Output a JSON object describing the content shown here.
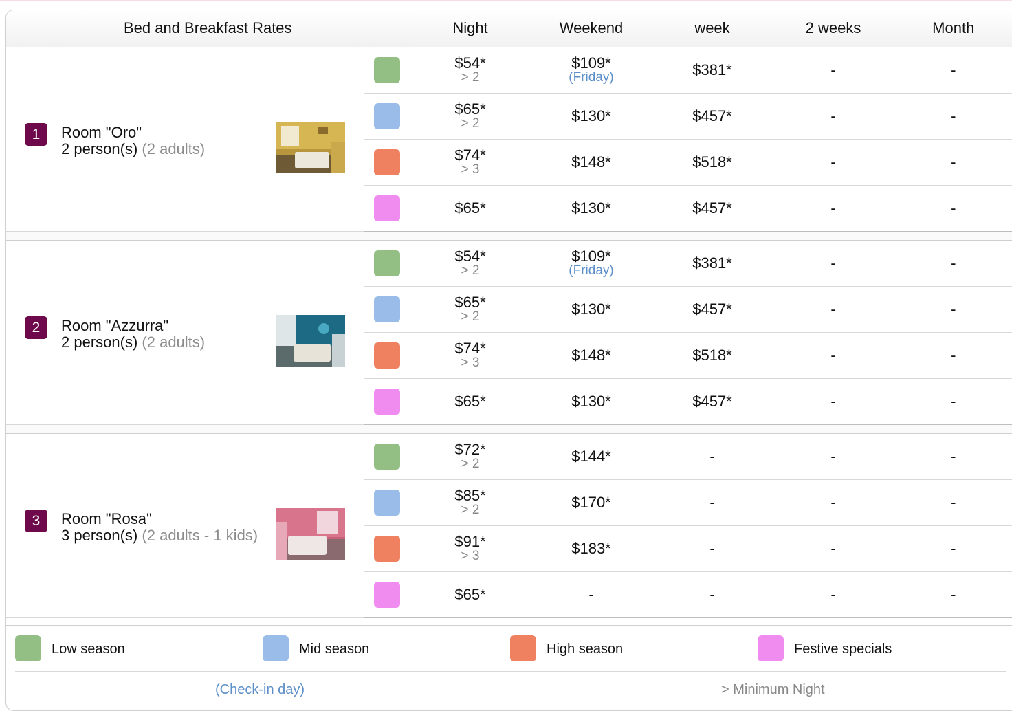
{
  "header": {
    "title": "Bed and Breakfast Rates",
    "cols": [
      "Night",
      "Weekend",
      "week",
      "2 weeks",
      "Month"
    ]
  },
  "colors": {
    "low": "#93bf85",
    "mid": "#99bde8",
    "high": "#ef8060",
    "festive": "#f08cef",
    "badge": "#6e0a4b",
    "link": "#5c8fc9"
  },
  "rooms": [
    {
      "num": "1",
      "name": "Room \"Oro\"",
      "persons": "2 person(s)",
      "adults": "(2 adults)",
      "rows": [
        {
          "season": "low",
          "night": "$54*",
          "night_min": "> 2",
          "weekend": "$109*",
          "weekend_sub": "(Friday)",
          "week": "$381*",
          "two_weeks": "-",
          "month": "-"
        },
        {
          "season": "mid",
          "night": "$65*",
          "night_min": "> 2",
          "weekend": "$130*",
          "weekend_sub": "",
          "week": "$457*",
          "two_weeks": "-",
          "month": "-"
        },
        {
          "season": "high",
          "night": "$74*",
          "night_min": "> 3",
          "weekend": "$148*",
          "weekend_sub": "",
          "week": "$518*",
          "two_weeks": "-",
          "month": "-"
        },
        {
          "season": "festive",
          "night": "$65*",
          "night_min": "",
          "weekend": "$130*",
          "weekend_sub": "",
          "week": "$457*",
          "two_weeks": "-",
          "month": "-"
        }
      ]
    },
    {
      "num": "2",
      "name": "Room \"Azzurra\"",
      "persons": "2 person(s)",
      "adults": "(2 adults)",
      "rows": [
        {
          "season": "low",
          "night": "$54*",
          "night_min": "> 2",
          "weekend": "$109*",
          "weekend_sub": "(Friday)",
          "week": "$381*",
          "two_weeks": "-",
          "month": "-"
        },
        {
          "season": "mid",
          "night": "$65*",
          "night_min": "> 2",
          "weekend": "$130*",
          "weekend_sub": "",
          "week": "$457*",
          "two_weeks": "-",
          "month": "-"
        },
        {
          "season": "high",
          "night": "$74*",
          "night_min": "> 3",
          "weekend": "$148*",
          "weekend_sub": "",
          "week": "$518*",
          "two_weeks": "-",
          "month": "-"
        },
        {
          "season": "festive",
          "night": "$65*",
          "night_min": "",
          "weekend": "$130*",
          "weekend_sub": "",
          "week": "$457*",
          "two_weeks": "-",
          "month": "-"
        }
      ]
    },
    {
      "num": "3",
      "name": "Room \"Rosa\"",
      "persons": "3 person(s)",
      "adults": "(2 adults - 1 kids)",
      "rows": [
        {
          "season": "low",
          "night": "$72*",
          "night_min": "> 2",
          "weekend": "$144*",
          "weekend_sub": "",
          "week": "-",
          "two_weeks": "-",
          "month": "-"
        },
        {
          "season": "mid",
          "night": "$85*",
          "night_min": "> 2",
          "weekend": "$170*",
          "weekend_sub": "",
          "week": "-",
          "two_weeks": "-",
          "month": "-"
        },
        {
          "season": "high",
          "night": "$91*",
          "night_min": "> 3",
          "weekend": "$183*",
          "weekend_sub": "",
          "week": "-",
          "two_weeks": "-",
          "month": "-"
        },
        {
          "season": "festive",
          "night": "$65*",
          "night_min": "",
          "weekend": "-",
          "weekend_sub": "",
          "week": "-",
          "two_weeks": "-",
          "month": "-"
        }
      ]
    }
  ],
  "legend": {
    "low": "Low season",
    "mid": "Mid season",
    "high": "High season",
    "festive": "Festive specials",
    "checkin": "(Check-in day)",
    "min_night": "> Minimum Night"
  }
}
